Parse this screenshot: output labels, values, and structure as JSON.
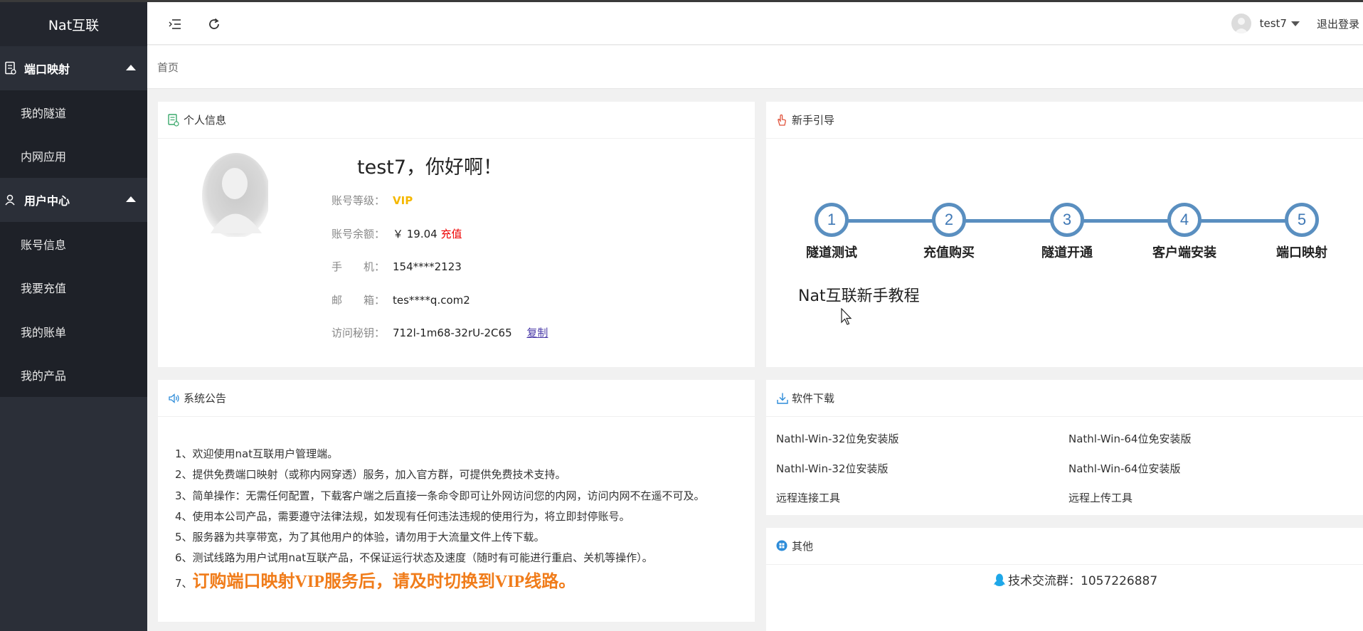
{
  "app": {
    "logo": "Nat互联"
  },
  "sidebar": {
    "groups": [
      {
        "label": "端口映射",
        "icon": "document-icon",
        "items": [
          "我的隧道",
          "内网应用"
        ]
      },
      {
        "label": "用户中心",
        "icon": "user-icon",
        "items": [
          "账号信息",
          "我要充值",
          "我的账单",
          "我的产品"
        ]
      }
    ]
  },
  "header": {
    "username": "test7",
    "logout": "退出登录",
    "icons": [
      "menu-fold-icon",
      "refresh-icon"
    ]
  },
  "breadcrumb": {
    "home": "首页"
  },
  "profile": {
    "title": "个人信息",
    "greeting": "test7，你好啊！",
    "level_label": "账号等级：",
    "level_value": "VIP",
    "balance_label": "账号余额：",
    "balance_value": "￥ 19.04",
    "recharge": "充值",
    "phone_label": "手　　机：",
    "phone_value": "154****2123",
    "email_label": "邮　　箱：",
    "email_value": "tes****q.com2",
    "key_label": "访问秘钥：",
    "key_value": "712l-1m68-32rU-2C65",
    "copy": "复制"
  },
  "guide": {
    "title": "新手引导",
    "steps": [
      {
        "num": "1",
        "label": "隧道测试"
      },
      {
        "num": "2",
        "label": "充值购买"
      },
      {
        "num": "3",
        "label": "隧道开通"
      },
      {
        "num": "4",
        "label": "客户端安装"
      },
      {
        "num": "5",
        "label": "端口映射"
      }
    ],
    "tutorial": "Nat互联新手教程"
  },
  "announcement": {
    "title": "系统公告",
    "items": [
      "1、欢迎使用nat互联用户管理端。",
      "2、提供免费端口映射（或称内网穿透）服务，加入官方群，可提供免费技术支持。",
      "3、简单操作：无需任何配置，下载客户端之后直接一条命令即可让外网访问您的内网，访问内网不在遥不可及。",
      "4、使用本公司产品，需要遵守法律法规，如发现有任何违法违规的使用行为，将立即封停账号。",
      "5、服务器为共享带宽，为了其他用户的体验，请勿用于大流量文件上传下载。",
      "6、测试线路为用户试用nat互联产品，不保证运行状态及速度（随时有可能进行重启、关机等操作）。"
    ],
    "highlight_prefix": "7、",
    "highlight": "订购端口映射VIP服务后，请及时切换到VIP线路。"
  },
  "downloads": {
    "title": "软件下载",
    "links": [
      "Nathl-Win-32位免安装版",
      "Nathl-Win-64位免安装版",
      "Nathl-Win-32位安装版",
      "Nathl-Win-64位安装版",
      "远程连接工具",
      "远程上传工具"
    ]
  },
  "other": {
    "title": "其他",
    "qq_group": "技术交流群：1057226887"
  },
  "colors": {
    "sidebar": "#2b2f38",
    "vip": "#f5b800",
    "accent_blue": "#5a8fc0",
    "highlight": "#f07c1a"
  }
}
